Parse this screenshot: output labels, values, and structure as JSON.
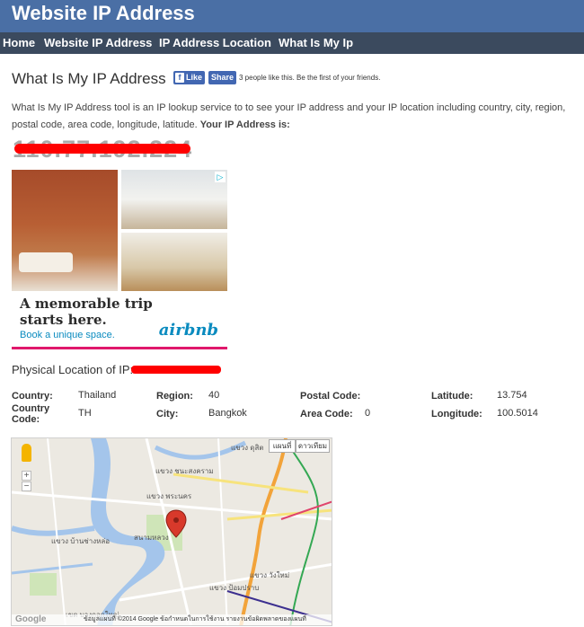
{
  "header": {
    "site_title": "Website IP Address"
  },
  "nav": {
    "items": [
      "Home",
      "Website IP Address",
      "IP Address Location",
      "What Is My Ip"
    ]
  },
  "main": {
    "title": "What Is My IP Address",
    "facebook": {
      "like_label": "Like",
      "share_label": "Share",
      "social_text": "3 people like this. Be the first of your friends."
    },
    "intro_text": "What Is My IP Address tool is an IP lookup service to to see your IP address and your IP location including country, city, region, postal code, area code, longitude, latitude.",
    "intro_bold": "Your IP Address is:",
    "ip_address_redacted": "110.77.192.224"
  },
  "ad": {
    "headline_line1": "A memorable trip",
    "headline_line2": "starts here.",
    "cta": "Book a unique space.",
    "brand": "airbnb",
    "choices_icon": "adchoices-icon"
  },
  "location": {
    "heading": "Physical Location of IP:",
    "ip_redacted": "110.77.192.224",
    "fields": {
      "country_label": "Country:",
      "country": "Thailand",
      "country_code_label": "Country Code:",
      "country_code": "TH",
      "region_label": "Region:",
      "region": "40",
      "city_label": "City:",
      "city": "Bangkok",
      "postal_code_label": "Postal Code:",
      "postal_code": "",
      "area_code_label": "Area Code:",
      "area_code": "0",
      "latitude_label": "Latitude:",
      "latitude": "13.754",
      "longitude_label": "Longitude:",
      "longitude": "100.5014"
    }
  },
  "map": {
    "map_button": "แผนที่",
    "satellite_button": "ดาวเทียม",
    "footer": "ข้อมูลแผนที่ ©2014 Google  ข้อกำหนดในการใช้งาน   รายงานข้อผิดพลาดของแผนที่",
    "google_logo": "Google",
    "zoom_in": "+",
    "zoom_out": "−",
    "labels": [
      "แขวง ดุสิต",
      "สนามหลวง",
      "แขวง วังใหม่",
      "แขวง พระนคร",
      "แขวง บ้านช่างหล่อ",
      "เขต บางกอกใหญ่",
      "แขวง ป้อมปราบ",
      "แขวง ชนะสงคราม"
    ],
    "pin_icon": "map-pin-icon",
    "pegman_icon": "pegman-icon"
  }
}
